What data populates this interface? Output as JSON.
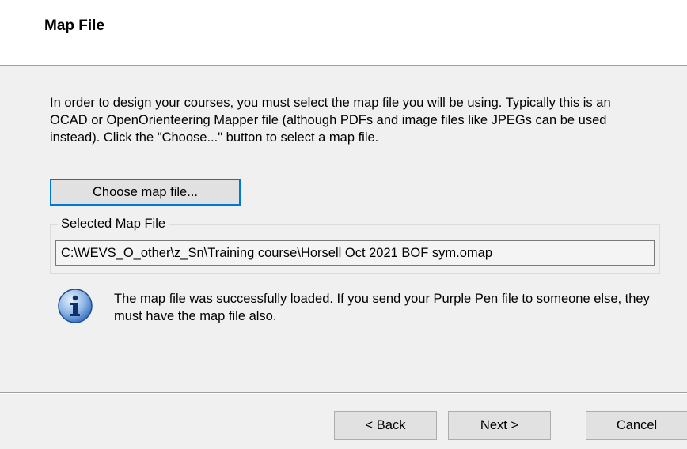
{
  "header": {
    "title": "Map File"
  },
  "intro": {
    "text": "In order to design your courses, you must select the map file you will be using. Typically this is an OCAD or OpenOrienteering Mapper file (although PDFs and image files like JPEGs can be used instead). Click the \"Choose...\" button to select a map file."
  },
  "choose_button": {
    "label": "Choose map file..."
  },
  "selected_map": {
    "legend": "Selected Map File",
    "path": "C:\\WEVS_O_other\\z_Sn\\Training course\\Horsell Oct 2021 BOF sym.omap"
  },
  "info": {
    "icon": "info-icon",
    "text": "The map file was successfully loaded. If you send your Purple Pen file to someone else, they must have the map file also."
  },
  "footer": {
    "back_label": "< Back",
    "next_label": "Next >",
    "cancel_label": "Cancel"
  },
  "colors": {
    "accent": "#0078d7",
    "header_bg": "#ffffff",
    "body_bg": "#f0f0f0",
    "button_bg": "#e1e1e1"
  }
}
